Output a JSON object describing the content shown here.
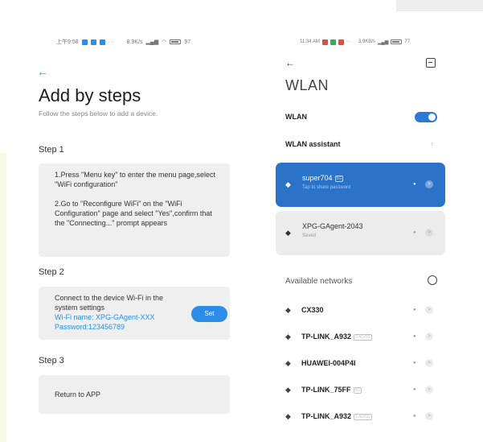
{
  "left_screen": {
    "status_bar": {
      "time": "上午9:58",
      "dots": "···",
      "speed": "8.9K/s",
      "network": "📶",
      "battery": "97"
    },
    "back_icon": "back-arrow-icon",
    "title": "Add by steps",
    "subtitle": "Follow the steps below to add a device.",
    "step1": {
      "title": "Step 1",
      "instruction1": "1.Press \"Menu key\" to enter the menu page,select \"WiFi configuration\"",
      "instruction2": "2.Go to \"Reconfigure WiFi\" on the \"WiFi Configuration\" page and select \"Yes\",confirm that the \"Connecting...\" prompt appears"
    },
    "step2": {
      "title": "Step 2",
      "text": "Connect to the device Wi-Fi in the system settings",
      "wifi_name": "Wi-Fi name: XPG-GAgent-XXX",
      "password": "Password:123456789",
      "button": "Set"
    },
    "step3": {
      "title": "Step 3",
      "text": "Return to APP"
    }
  },
  "right_screen": {
    "status_bar": {
      "time": "11:34 AM",
      "dots": "···",
      "speed": "3.9KB/s",
      "battery": "77"
    },
    "title": "WLAN",
    "wlan_label": "WLAN",
    "wlan_enabled": true,
    "assistant_label": "WLAN assistant",
    "connected": {
      "name": "super704",
      "tag": "5G",
      "status": "Tap to share password"
    },
    "saved": {
      "name": "XPG-GAgent-2043",
      "status": "Saved"
    },
    "available_label": "Available networks",
    "networks": [
      {
        "name": "CX330",
        "tag": ""
      },
      {
        "name": "TP-LINK_A932",
        "tag": "2.4G/5G"
      },
      {
        "name": "HUAWEI-004P4I",
        "tag": ""
      },
      {
        "name": "TP-LINK_75FF",
        "tag": "5G"
      },
      {
        "name": "TP-LINK_A932",
        "tag": "2.4G/5G"
      }
    ]
  },
  "colors": {
    "accent": "#2b8de8",
    "active_card": "#2b73c9",
    "toggle": "#2b7ad9"
  }
}
